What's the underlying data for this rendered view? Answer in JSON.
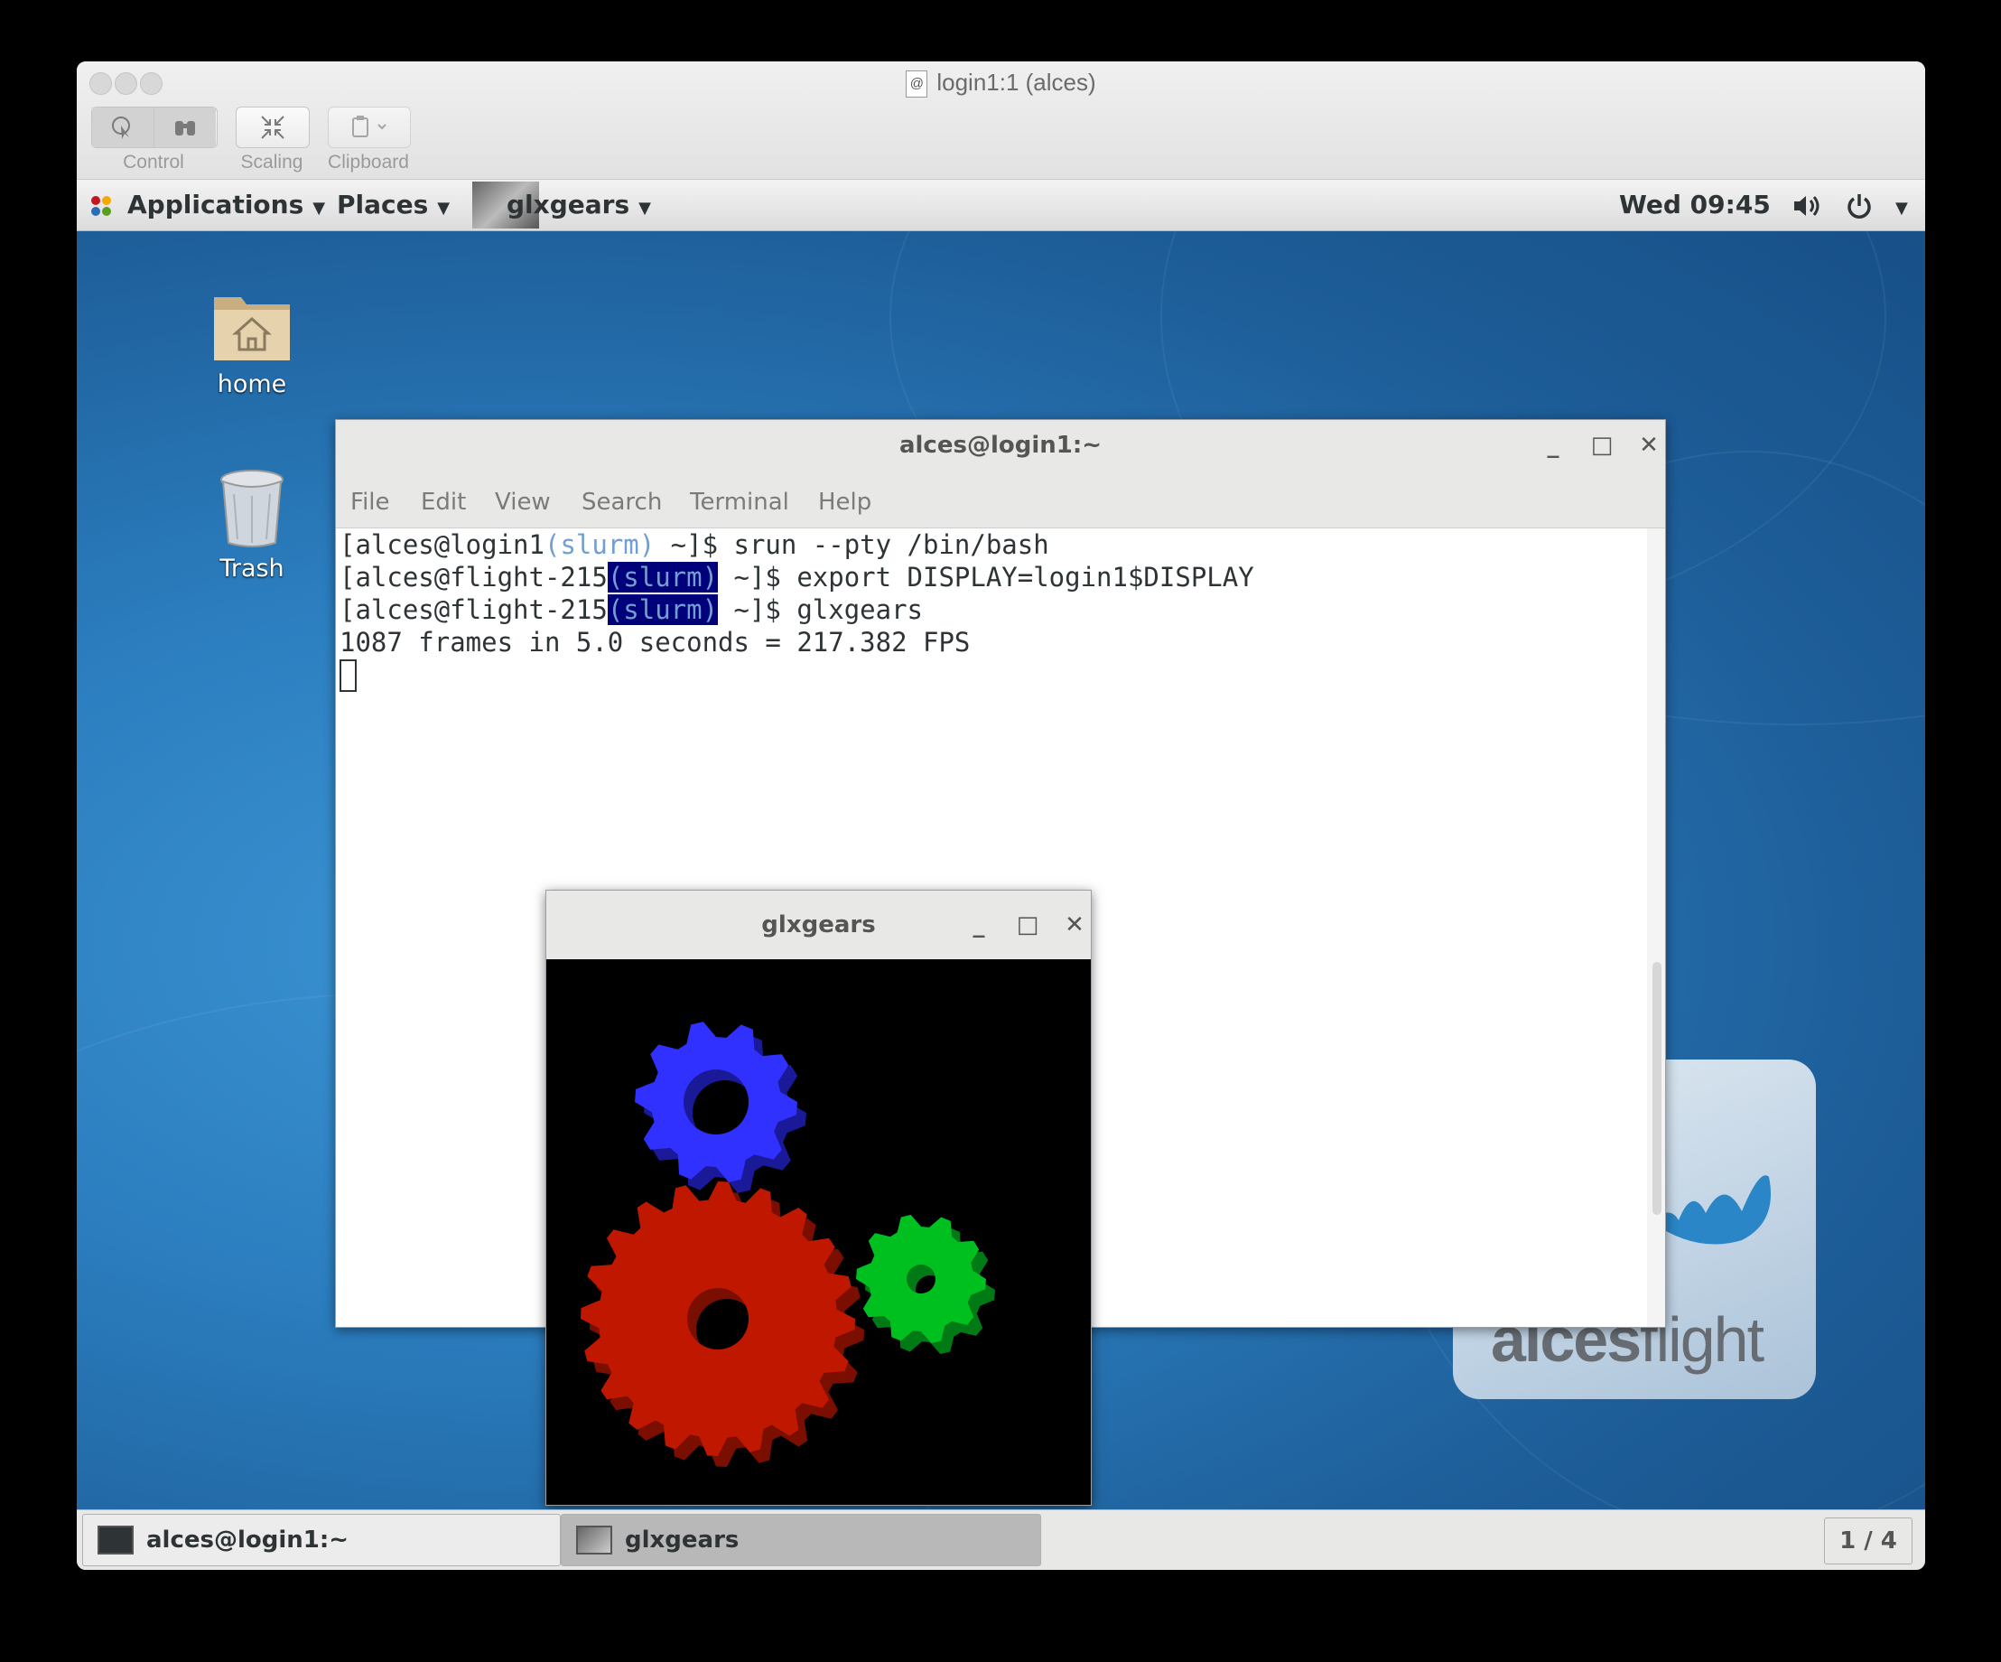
{
  "mac_window": {
    "title": "login1:1 (alces)",
    "toolbar": {
      "control_label": "Control",
      "scaling_label": "Scaling",
      "clipboard_label": "Clipboard"
    }
  },
  "topbar": {
    "applications": "Applications",
    "places": "Places",
    "active_app": "glxgears",
    "clock": "Wed 09:45"
  },
  "desktop_icons": {
    "home": "home",
    "trash": "Trash"
  },
  "terminal": {
    "title": "alces@login1:~",
    "menu": [
      "File",
      "Edit",
      "View",
      "Search",
      "Terminal",
      "Help"
    ],
    "lines": {
      "l1_pre": "[alces@login1",
      "l1_slurm": "(slurm)",
      "l1_post": " ~]$ srun --pty /bin/bash",
      "l2_pre": "[alces@flight-215",
      "l2_slurm": "(slurm)",
      "l2_post": " ~]$ export DISPLAY=login1$DISPLAY",
      "l3_pre": "[alces@flight-215",
      "l3_slurm": "(slurm)",
      "l3_post": " ~]$ glxgears",
      "l4": "1087 frames in 5.0 seconds = 217.382 FPS"
    }
  },
  "glxgears_window": {
    "title": "glxgears"
  },
  "logo": {
    "text_bold": "alces",
    "text_light": "flight"
  },
  "taskbar": {
    "items": [
      "alces@login1:~",
      "glxgears"
    ],
    "workspace": "1 / 4"
  },
  "colors": {
    "gear_red": "#c01800",
    "gear_green": "#00c020",
    "gear_blue": "#3030ff",
    "slurm_highlight_bg": "#00007a",
    "slurm_text": "#729fcf"
  }
}
